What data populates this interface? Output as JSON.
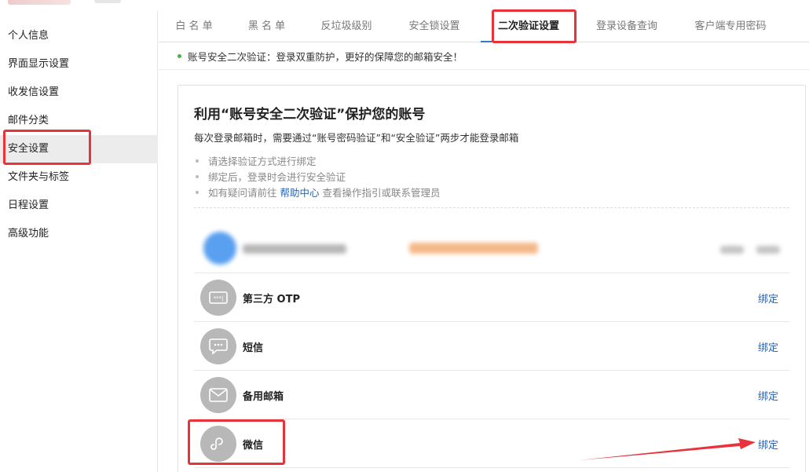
{
  "sidebar": {
    "items": [
      {
        "label": "个人信息"
      },
      {
        "label": "界面显示设置"
      },
      {
        "label": "收发信设置"
      },
      {
        "label": "邮件分类"
      },
      {
        "label": "安全设置",
        "active": true
      },
      {
        "label": "文件夹与标签"
      },
      {
        "label": "日程设置"
      },
      {
        "label": "高级功能"
      }
    ]
  },
  "tabs": [
    {
      "label": "白 名 单"
    },
    {
      "label": "黑 名 单"
    },
    {
      "label": "反垃圾级别"
    },
    {
      "label": "安全锁设置"
    },
    {
      "label": "二次验证设置",
      "active": true
    },
    {
      "label": "登录设备查询"
    },
    {
      "label": "客户端专用密码"
    }
  ],
  "notice": "账号安全二次验证：登录双重防护，更好的保障您的邮箱安全！",
  "card": {
    "title": "利用“账号安全二次验证”保护您的账号",
    "desc": "每次登录邮箱时，需要通过“账号密码验证”和“安全验证”两步才能登录邮箱",
    "tips": [
      {
        "text": "请选择验证方式进行绑定"
      },
      {
        "text": "绑定后，登录时会进行安全验证"
      }
    ],
    "tip3": {
      "before": "如有疑问请前往 ",
      "link": "帮助中心",
      "after": " 查看操作指引或联系管理员"
    }
  },
  "methods": [
    {
      "icon": "otp-icon",
      "label": "第三方 OTP",
      "action": "绑定"
    },
    {
      "icon": "sms-icon",
      "label": "短信",
      "action": "绑定"
    },
    {
      "icon": "mail-icon",
      "label": "备用邮箱",
      "action": "绑定"
    },
    {
      "icon": "wechat-mini-icon",
      "label": "微信",
      "action": "绑定"
    }
  ],
  "colors": {
    "accent": "#3a77c9",
    "link": "#2a62b0",
    "annotation": "#e8333b",
    "icon_bg": "#b8b8b8"
  }
}
